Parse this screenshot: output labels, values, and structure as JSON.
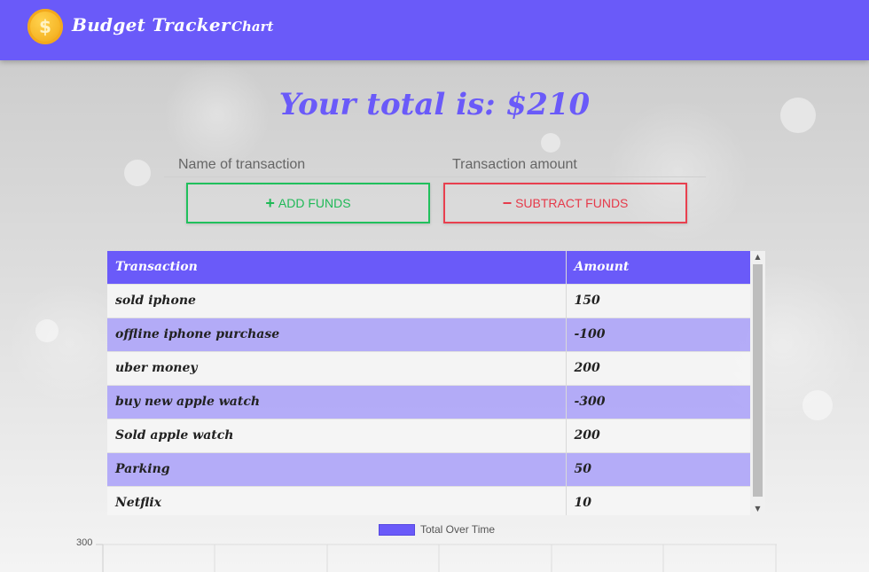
{
  "header": {
    "logo_symbol": "$",
    "brand": "Budget Tracker",
    "nav_chart": "Chart",
    "color": "#6a5af9"
  },
  "summary": {
    "total_text": "Your total is: $210"
  },
  "form": {
    "name_placeholder": "Name of transaction",
    "amount_placeholder": "Transaction amount",
    "add_label": "ADD FUNDS",
    "subtract_label": "SUBTRACT FUNDS",
    "add_icon": "plus-icon",
    "subtract_icon": "minus-icon",
    "add_color": "#20c05c",
    "subtract_color": "#e8404f"
  },
  "table": {
    "headers": [
      "Transaction",
      "Amount"
    ],
    "rows": [
      {
        "name": "sold iphone",
        "amount": "150"
      },
      {
        "name": "offline iphone purchase",
        "amount": "-100"
      },
      {
        "name": "uber money",
        "amount": "200"
      },
      {
        "name": "buy new apple watch",
        "amount": "-300"
      },
      {
        "name": "Sold apple watch",
        "amount": "200"
      },
      {
        "name": "Parking",
        "amount": "50"
      },
      {
        "name": "Netflix",
        "amount": "10"
      }
    ]
  },
  "chart": {
    "legend_label": "Total Over Time",
    "y_top_tick": "300",
    "series_color": "#6a5af9"
  }
}
